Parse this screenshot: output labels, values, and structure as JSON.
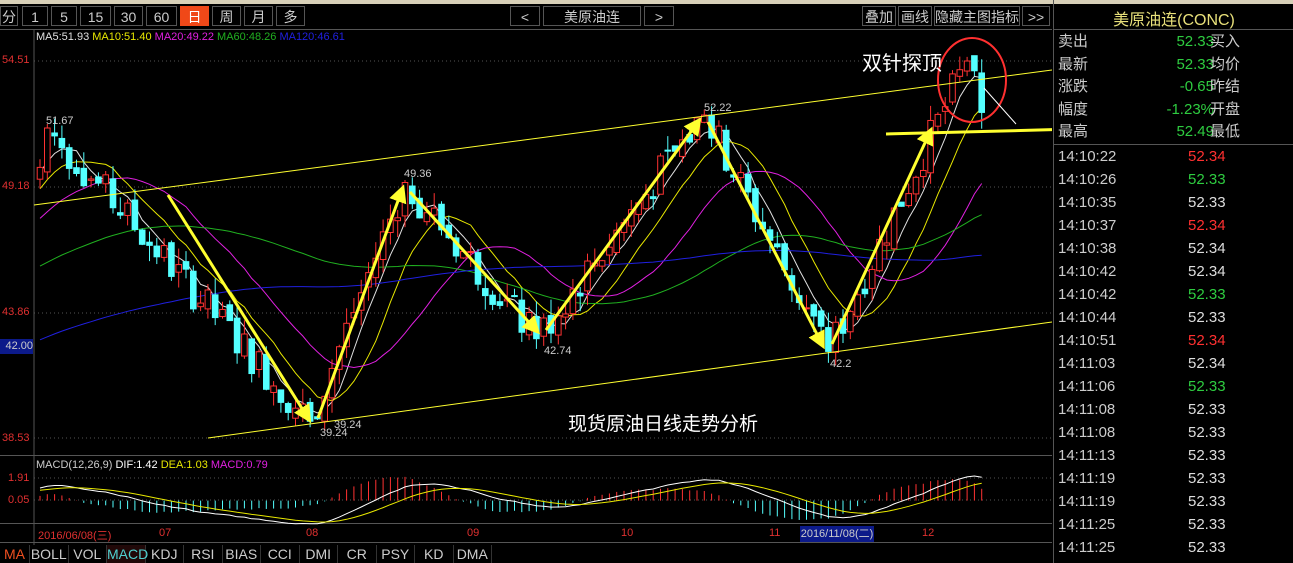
{
  "toolbar": {
    "periods": [
      "分",
      "1",
      "5",
      "15",
      "30",
      "60",
      "日",
      "周",
      "月",
      "多"
    ],
    "active": "日",
    "prev": "<",
    "symbol": "美原油连",
    "next": ">",
    "overlay": "叠加",
    "draw": "画线",
    "hide_indicators": "隐藏主图指标",
    "more": ">>"
  },
  "ma_legend": {
    "ma5": "MA5:51.93",
    "ma10": "MA10:51.40",
    "ma20": "MA20:49.22",
    "ma60": "MA60:48.26",
    "ma120": "MA120:46.61"
  },
  "colors": {
    "up": "#ff3232",
    "down": "#54ffff",
    "ma5": "#e0e0e0",
    "ma10": "#e8e800",
    "ma20": "#e020e0",
    "ma60": "#20b020",
    "ma120": "#2020e0",
    "annotation": "#ffff30"
  },
  "price_axis": [
    "54.51",
    "49.18",
    "43.86",
    "38.53"
  ],
  "crosshair_price": "42.00",
  "price_labels": [
    "51.67",
    "49.36",
    "39.24",
    "39.24",
    "42.74",
    "52.22",
    "42.2"
  ],
  "annotations": {
    "top_text": "双针探顶",
    "caption": "现货原油日线走势分析"
  },
  "macd": {
    "legend": "MACD(12,26,9)",
    "dif": "DIF:1.42",
    "dea": "DEA:1.03",
    "macd": "MACD:0.79",
    "axis": [
      "1.91",
      "0.05"
    ]
  },
  "date_axis": {
    "start": "2016/06/08(三)",
    "months": [
      "07",
      "08",
      "09",
      "10",
      "11",
      "12"
    ],
    "cursor_date": "2016/11/08(二)"
  },
  "indicator_tabs": [
    "MA",
    "BOLL",
    "VOL",
    "MACD",
    "KDJ",
    "RSI",
    "BIAS",
    "CCI",
    "DMI",
    "CR",
    "PSY",
    "KD",
    "DMA"
  ],
  "quote": {
    "title": "美原油连(CONC)",
    "rows": [
      {
        "label": "卖出",
        "value": "52.33",
        "label2": "买入"
      },
      {
        "label": "最新",
        "value": "52.33",
        "label2": "均价"
      },
      {
        "label": "涨跌",
        "value": "-0.65",
        "label2": "昨结"
      },
      {
        "label": "幅度",
        "value": "-1.23%",
        "label2": "开盘"
      },
      {
        "label": "最高",
        "value": "52.49",
        "label2": "最低"
      }
    ]
  },
  "ticks": [
    {
      "time": "14:10:22",
      "price": "52.34",
      "dir": "up"
    },
    {
      "time": "14:10:26",
      "price": "52.33",
      "dir": "down"
    },
    {
      "time": "14:10:35",
      "price": "52.33",
      "dir": "flat"
    },
    {
      "time": "14:10:37",
      "price": "52.34",
      "dir": "up"
    },
    {
      "time": "14:10:38",
      "price": "52.34",
      "dir": "flat"
    },
    {
      "time": "14:10:42",
      "price": "52.34",
      "dir": "flat"
    },
    {
      "time": "14:10:42",
      "price": "52.33",
      "dir": "down"
    },
    {
      "time": "14:10:44",
      "price": "52.33",
      "dir": "flat"
    },
    {
      "time": "14:10:51",
      "price": "52.34",
      "dir": "up"
    },
    {
      "time": "14:11:03",
      "price": "52.34",
      "dir": "flat"
    },
    {
      "time": "14:11:06",
      "price": "52.33",
      "dir": "down"
    },
    {
      "time": "14:11:08",
      "price": "52.33",
      "dir": "flat"
    },
    {
      "time": "14:11:08",
      "price": "52.33",
      "dir": "flat"
    },
    {
      "time": "14:11:13",
      "price": "52.33",
      "dir": "flat"
    },
    {
      "time": "14:11:19",
      "price": "52.33",
      "dir": "flat"
    },
    {
      "time": "14:11:19",
      "price": "52.33",
      "dir": "flat"
    },
    {
      "time": "14:11:25",
      "price": "52.33",
      "dir": "flat"
    },
    {
      "time": "14:11:25",
      "price": "52.33",
      "dir": "flat"
    }
  ],
  "chart_data": {
    "type": "candlestick",
    "pivots": [
      [
        0,
        50.0
      ],
      [
        1,
        51.67
      ],
      [
        37,
        39.24
      ],
      [
        50,
        49.36
      ],
      [
        68,
        42.74
      ],
      [
        91,
        52.22
      ],
      [
        108,
        42.2
      ],
      [
        127,
        54.51
      ],
      [
        129,
        52.33
      ]
    ],
    "count": 130,
    "ylim": [
      38.53,
      54.51
    ]
  }
}
